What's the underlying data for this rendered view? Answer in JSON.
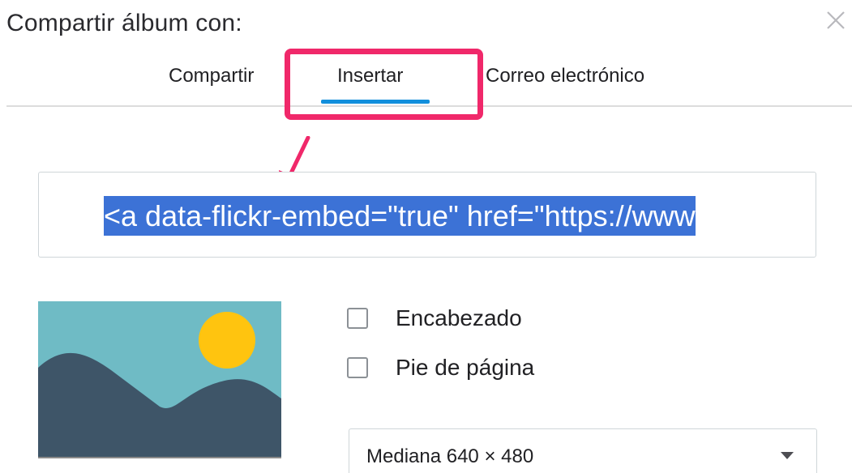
{
  "dialog": {
    "title": "Compartir álbum con:",
    "close_icon": "close-icon"
  },
  "tabs": [
    {
      "label": "Compartir",
      "active": false
    },
    {
      "label": "Insertar",
      "active": true
    },
    {
      "label": "Correo electrónico",
      "active": false
    }
  ],
  "annotation": {
    "highlight_color": "#f0286a",
    "arrow_icon": "arrow-down-left-icon"
  },
  "embed": {
    "code": "<a data-flickr-embed=\"true\"  href=\"https://www",
    "selection_color": "#3c72d6"
  },
  "preview": {
    "icon": "landscape-placeholder-icon",
    "sky_color": "#6fbbc5",
    "sun_color": "#ffc40f",
    "hills_color": "#3e5568"
  },
  "options": {
    "header_label": "Encabezado",
    "header_checked": false,
    "footer_label": "Pie de página",
    "footer_checked": false
  },
  "size_select": {
    "value": "Mediana 640 × 480"
  },
  "colors": {
    "accent": "#128fdc",
    "divider": "#dcdcdc"
  }
}
